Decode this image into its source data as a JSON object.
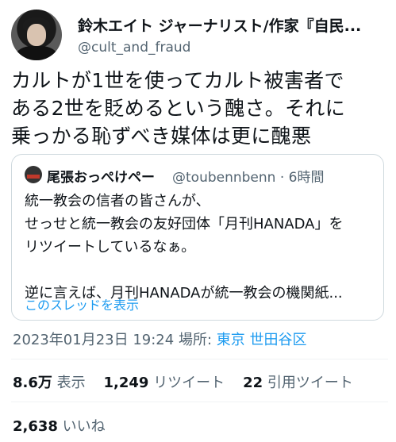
{
  "author": {
    "display_name": "鈴木エイト ジャーナリスト/作家『自民...",
    "handle": "@cult_and_fraud"
  },
  "tweet": {
    "text_line1": "カルトが1世を使ってカルト被害者で",
    "text_line2": "ある2世を貶めるという醜さ。それに",
    "text_line3": "乗っかる恥ずべき媒体は更に醜悪"
  },
  "quoted": {
    "name": "尾張おっぺけペー",
    "handle_time": "@toubennbenn · 6時間",
    "lines": [
      "統一教会の信者の皆さんが、",
      "せっせと統一教会の友好団体「月刊HANADA」を",
      "リツイートしているなぁ。",
      "",
      "逆に言えば、月刊HANADAが統一教会の機関紙..."
    ],
    "show_thread": "このスレッドを表示"
  },
  "meta": {
    "timestamp": "2023年01月23日 19:24",
    "location_label": "場所:",
    "location": "東京 世田谷区"
  },
  "stats": {
    "views_count": "8.6万",
    "views_label": "表示",
    "retweets_count": "1,249",
    "retweets_label": "リツイート",
    "quotes_count": "22",
    "quotes_label": "引用ツイート",
    "likes_count": "2,638",
    "likes_label": "いいね"
  },
  "colors": {
    "link": "#1d9bf0",
    "secondary": "#536471",
    "border": "#cfd9de"
  }
}
